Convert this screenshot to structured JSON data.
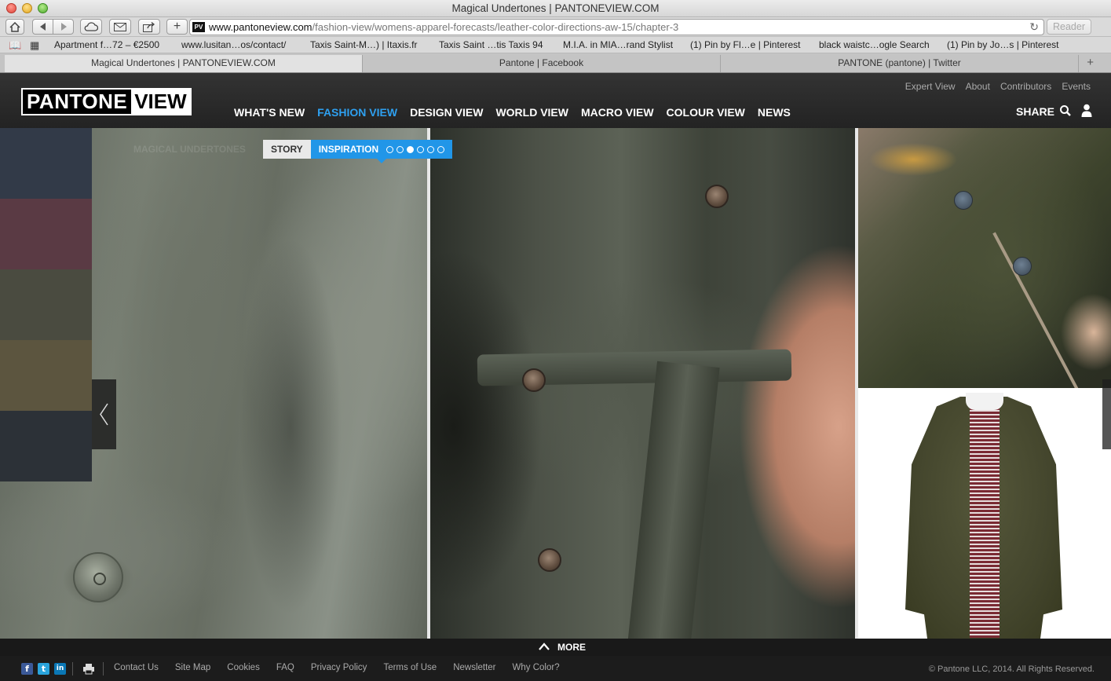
{
  "window": {
    "title": "Magical Undertones | PANTONEVIEW.COM"
  },
  "toolbar": {
    "url_host": "www.pantoneview.com",
    "url_path": "/fashion-view/womens-apparel-forecasts/leather-color-directions-aw-15/chapter-3",
    "favicon_text": "PV",
    "reader_label": "Reader"
  },
  "bookmarks": [
    "Apartment f…72 – €2500",
    "www.lusitan…os/contact/",
    "Taxis Saint-M…) | Itaxis.fr",
    "Taxis Saint …tis Taxis 94",
    "M.I.A. in MIA…rand Stylist",
    "(1) Pin by Fl…e | Pinterest",
    "black waistc…ogle Search",
    "(1) Pin by Jo…s | Pinterest"
  ],
  "tabs": [
    {
      "label": "Magical Undertones | PANTONEVIEW.COM"
    },
    {
      "label": "Pantone | Facebook"
    },
    {
      "label": "PANTONE (pantone) | Twitter"
    }
  ],
  "site": {
    "logo_left": "PANTONE",
    "logo_right": "VIEW",
    "nav": [
      "WHAT'S NEW",
      "FASHION VIEW",
      "DESIGN VIEW",
      "WORLD VIEW",
      "MACRO VIEW",
      "COLOUR VIEW",
      "NEWS"
    ],
    "active_nav": "FASHION VIEW",
    "util_nav": [
      "Expert View",
      "About",
      "Contributors",
      "Events"
    ],
    "share_label": "SHARE"
  },
  "chapter": {
    "watermark": "MAGICAL UNDERTONES",
    "story_label": "STORY",
    "inspiration_label": "INSPIRATION",
    "dots_total": 6,
    "dots_active_index": 2
  },
  "swatches": [
    "#323a48",
    "#5a3a44",
    "#4a4b40",
    "#5c553f",
    "#2c3137"
  ],
  "more_label": "MORE",
  "footer": {
    "links": [
      "Contact Us",
      "Site Map",
      "Cookies",
      "FAQ",
      "Privacy Policy",
      "Terms of Use",
      "Newsletter",
      "Why Color?"
    ],
    "copyright": "© Pantone LLC, 2014. All Rights Reserved.",
    "social": [
      "f",
      "t",
      "in"
    ]
  },
  "colors": {
    "accent": "#2196e8",
    "header_bg": "#2b2b2b"
  }
}
